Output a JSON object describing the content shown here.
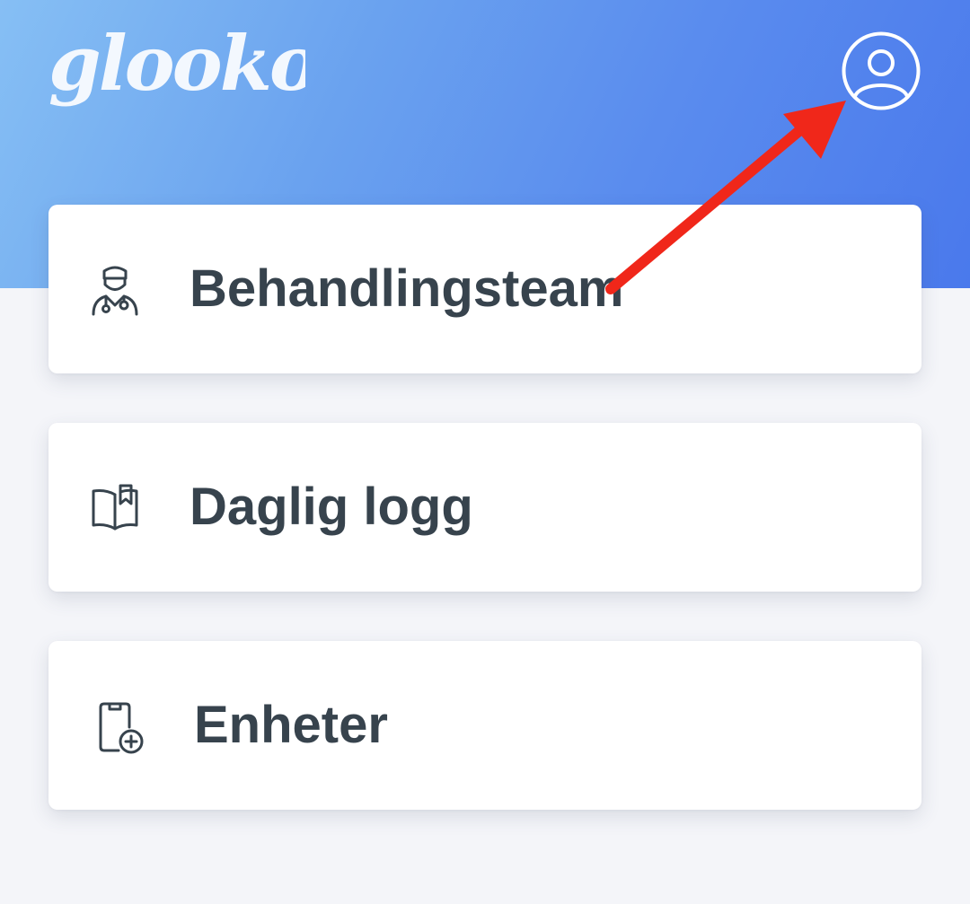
{
  "brand": {
    "logo_text": "glooko"
  },
  "header": {
    "profile_icon": "user-circle-icon"
  },
  "menu": {
    "items": [
      {
        "label": "Behandlingsteam",
        "icon": "doctor-icon"
      },
      {
        "label": "Daglig logg",
        "icon": "open-book-icon"
      },
      {
        "label": "Enheter",
        "icon": "device-plus-icon"
      }
    ]
  },
  "colors": {
    "header_gradient_start": "#86bff4",
    "header_gradient_end": "#4a79ec",
    "text": "#37434d",
    "background": "#f4f5f9",
    "annotation_arrow": "#f0271a"
  }
}
